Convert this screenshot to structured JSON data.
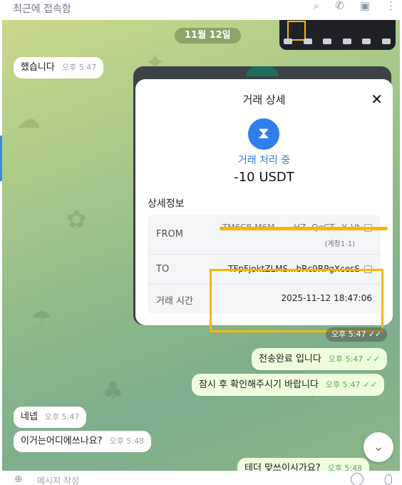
{
  "topbar": {
    "status": "최근에 접속함",
    "icons": [
      "search-icon",
      "phone-icon",
      "sidebar-icon",
      "more-icon"
    ]
  },
  "chat": {
    "date": "11월 12일",
    "messages": [
      {
        "text": "했습니다",
        "time": "오후 5:47",
        "dir": "in"
      },
      {
        "text": "전송완료 입니다",
        "time": "오후 5:47",
        "dir": "out"
      },
      {
        "text": "잠시 후 확인해주시기 바랍니다",
        "time": "오후 5:47",
        "dir": "out"
      },
      {
        "text": "네넵",
        "time": "오후 5:47",
        "dir": "in"
      },
      {
        "text": "이거는어디에쓰나요?",
        "time": "오후 5:48",
        "dir": "in"
      },
      {
        "text": "테더 맞쓰이시가요?",
        "time": "오후 5:48",
        "dir": "out"
      }
    ]
  },
  "card": {
    "title": "거래 상세",
    "status": "거래 처리 중",
    "amount": "-10 USDT",
    "section_title": "상세정보",
    "rows": {
      "from_label": "FROM",
      "from_value": "TM6C8 M6M...... HZ..QeCT...Y..Vt",
      "from_sub": "(계정1-1)",
      "to_label": "TO",
      "to_value": "TFpFjoktZLMS...bRc9RPgXcesS",
      "time_label": "거래 시간",
      "time_value": "2025-11-12 18:47:06"
    },
    "timestamp": "오후 5:47"
  },
  "bottombar": {
    "placeholder": "메시지 작성"
  },
  "colors": {
    "accent": "#2f80ed",
    "highlight": "#f5b800",
    "outgoing_bubble": "#effdde"
  }
}
